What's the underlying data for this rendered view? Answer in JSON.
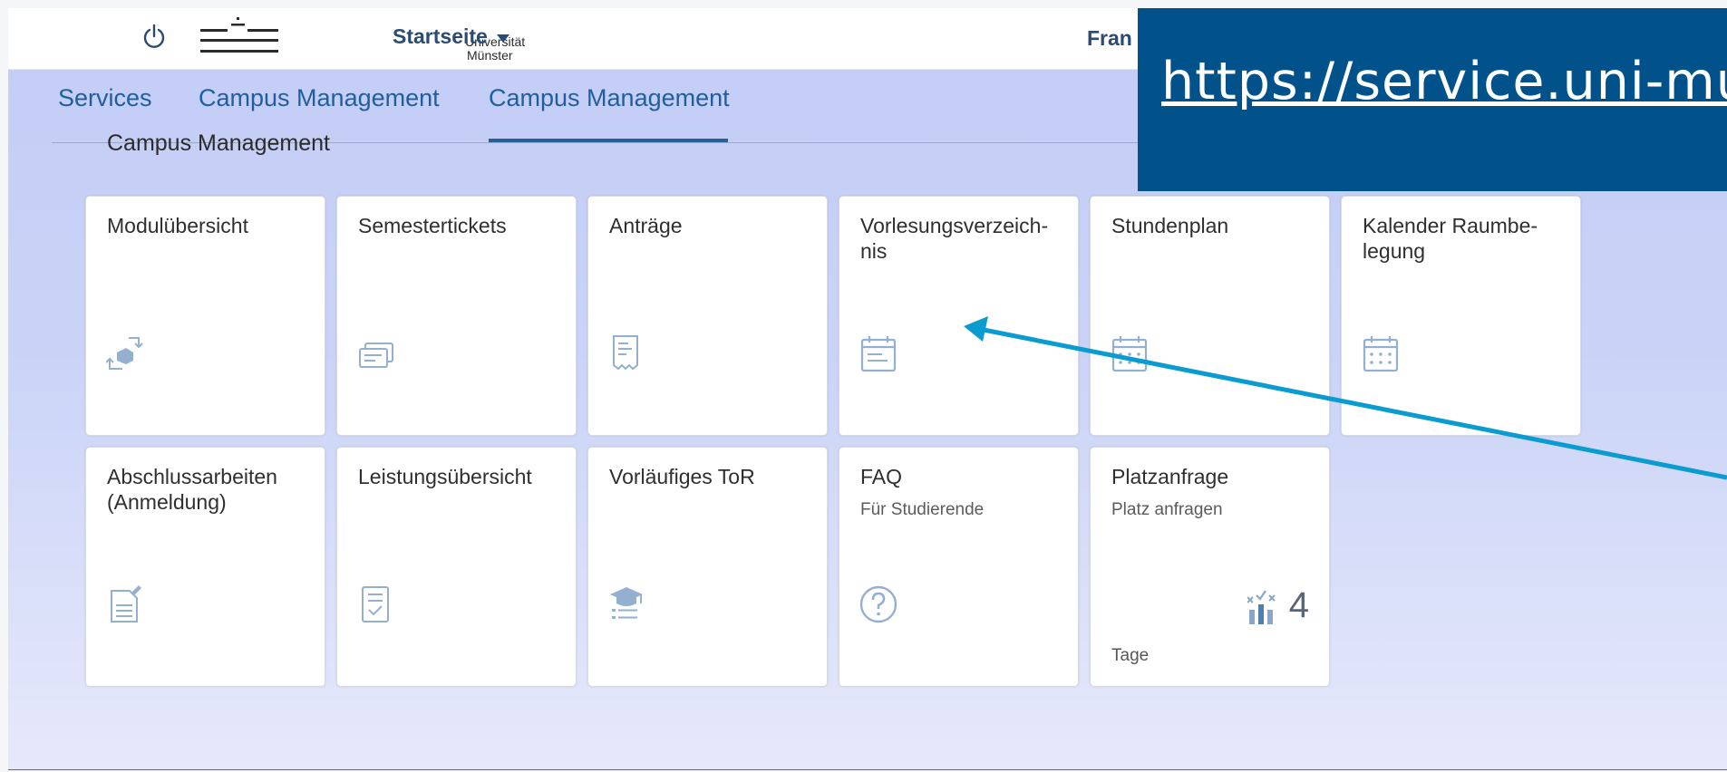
{
  "header": {
    "logo_line1": "Universität",
    "logo_line2": "Münster",
    "home_menu": "Startseite",
    "user_name_partial": "Fran"
  },
  "tabs": [
    {
      "label": "Services"
    },
    {
      "label": "Campus Management"
    },
    {
      "label": "Campus Management",
      "selected": true
    }
  ],
  "section_title": "Campus Management",
  "tiles": [
    {
      "title": "Modulübersicht",
      "icon": "modules-icon"
    },
    {
      "title": "Semestertickets",
      "icon": "tickets-icon"
    },
    {
      "title": "Anträge",
      "icon": "receipt-icon"
    },
    {
      "title": "Vorlesungsverzeich-nis",
      "icon": "calendar-icon"
    },
    {
      "title": "Stundenplan",
      "icon": "calendar-icon"
    },
    {
      "title": "Kalender Raumbe-legung",
      "icon": "calendar-icon"
    },
    {
      "title": "Abschlussarbeiten (Anmeldung)",
      "icon": "document-edit-icon"
    },
    {
      "title": "Leistungsübersicht",
      "icon": "checklist-icon"
    },
    {
      "title": "Vorläufiges ToR",
      "icon": "graduation-icon"
    },
    {
      "title": "FAQ",
      "subtitle": "Für Studierende",
      "icon": "question-icon"
    },
    {
      "title": "Platzanfrage",
      "subtitle": "Platz anfragen",
      "kpi": "4",
      "footer": "Tage",
      "icon": "chart-icon"
    }
  ],
  "overlay": {
    "url": "https://service.uni-mue"
  },
  "colors": {
    "banner": "#01518a",
    "arrow": "#0a9bd0",
    "accent": "#2a5f95"
  }
}
